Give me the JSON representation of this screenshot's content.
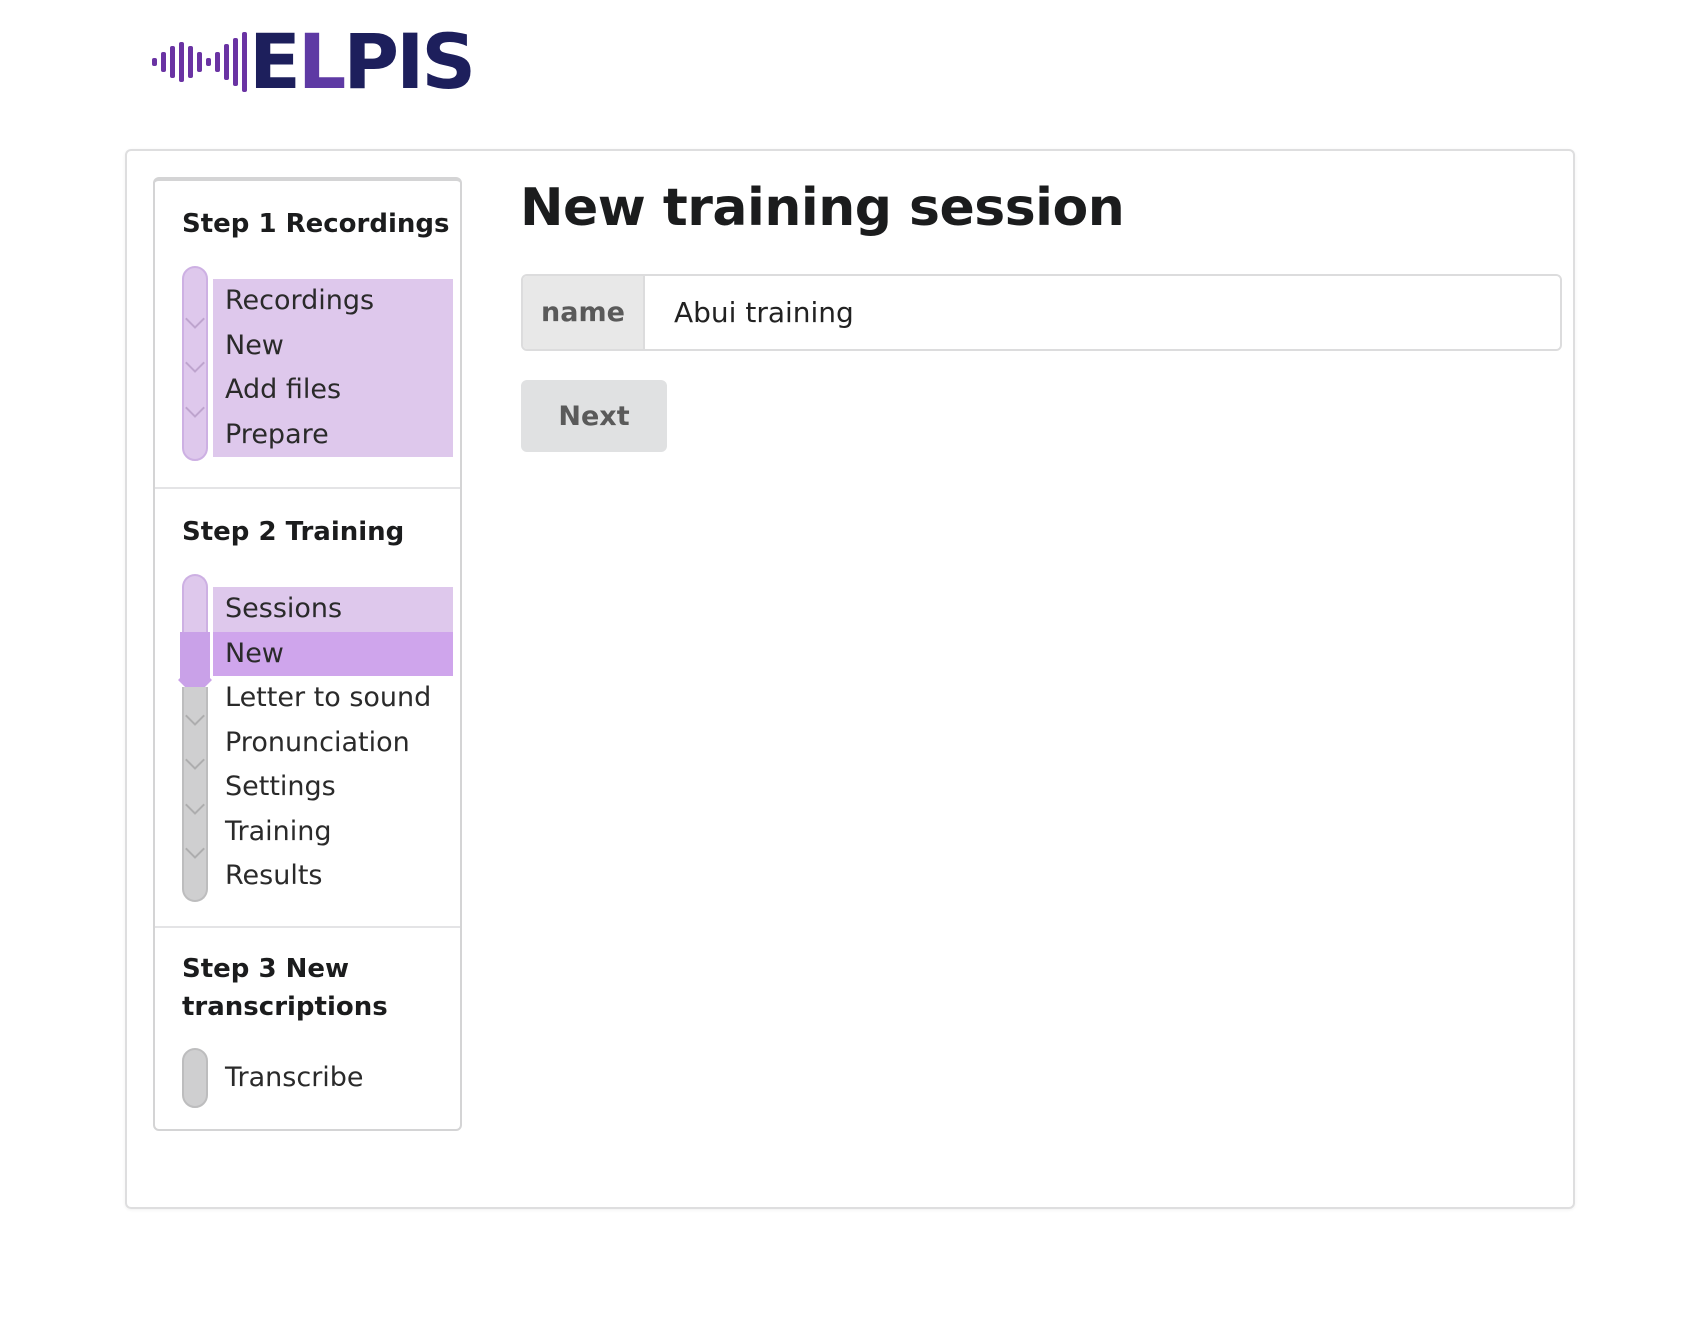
{
  "logo": {
    "text": "ELPIS",
    "icon": "soundwave-icon",
    "colors": {
      "wave": "#6a33a3",
      "text_dark": "#1d1f5c",
      "text_accent": "#5e3aa4"
    }
  },
  "sidebar": {
    "steps": [
      {
        "title": "Step 1 Recordings",
        "items": [
          {
            "label": "Recordings",
            "state": "completed"
          },
          {
            "label": "New",
            "state": "completed"
          },
          {
            "label": "Add files",
            "state": "completed"
          },
          {
            "label": "Prepare",
            "state": "completed"
          }
        ]
      },
      {
        "title": "Step 2 Training",
        "items": [
          {
            "label": "Sessions",
            "state": "completed"
          },
          {
            "label": "New",
            "state": "active"
          },
          {
            "label": "Letter to sound",
            "state": "pending"
          },
          {
            "label": "Pronunciation",
            "state": "pending"
          },
          {
            "label": "Settings",
            "state": "pending"
          },
          {
            "label": "Training",
            "state": "pending"
          },
          {
            "label": "Results",
            "state": "pending"
          }
        ]
      },
      {
        "title": "Step 3 New transcriptions",
        "items": [
          {
            "label": "Transcribe",
            "state": "pending"
          }
        ]
      }
    ]
  },
  "main": {
    "title": "New training session",
    "name_field": {
      "label": "name",
      "value": "Abui training",
      "placeholder": ""
    },
    "next_button": "Next"
  },
  "colors": {
    "completed": "#dec8ec",
    "active": "#cfa5ec",
    "pending": "#cfcfd0"
  }
}
